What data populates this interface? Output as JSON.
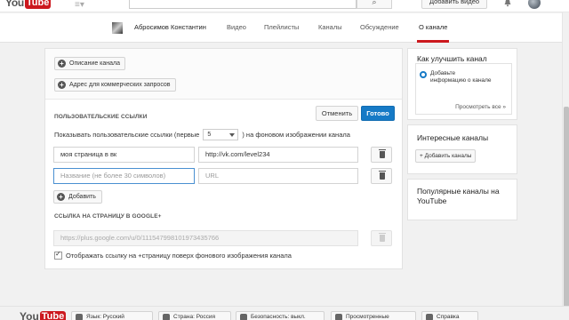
{
  "topbar": {
    "logo_you": "You",
    "logo_tube": "Tube",
    "search_button_icon": "search-icon",
    "upload_label": "Добавить видео",
    "notification_icon": "bell-icon"
  },
  "channel_nav": {
    "channel_name": "Абросимов Константин",
    "tabs": [
      {
        "label": "Видео"
      },
      {
        "label": "Плейлисты"
      },
      {
        "label": "Каналы"
      },
      {
        "label": "Обсуждение"
      },
      {
        "label": "О канале"
      }
    ],
    "active_tab": "О канале",
    "accent_color": "#cc181e"
  },
  "about": {
    "description_button": "Описание канала",
    "business_email_button": "Адрес для коммерческих запросов",
    "links_section_title": "ПОЛЬЗОВАТЕЛЬСКИЕ ССЫЛКИ",
    "cancel_label": "Отменить",
    "done_label": "Готово",
    "show_links_prefix": "Показывать пользовательские ссылки (первые",
    "show_links_count": "5",
    "show_links_suffix": ") на фоновом изображении канала",
    "links": [
      {
        "title": "моя страница в вк",
        "url": "http://vk.com/level234"
      },
      {
        "title_placeholder": "Название (не более 30 символов)",
        "url_placeholder": "URL"
      }
    ],
    "add_label": "Добавить",
    "google_section_title": "ССЫЛКА НА СТРАНИЦУ В GOOGLE+",
    "google_url": "https://plus.google.com/u/0/111547998101973435766",
    "show_google_checkbox": "Отображать ссылку на +страницу поверх фонового изображения канала",
    "show_google_checked": true,
    "primary_color": "#167ac6"
  },
  "sidebar": {
    "improve_title": "Как улучшить канал",
    "improve_tip": "Добавьте информацию о канале",
    "improve_see_all": "Просмотреть все »",
    "featured_title": "Интересные каналы",
    "featured_add": "+ Добавить каналы",
    "popular_title": "Популярные каналы на YouTube"
  },
  "footer": {
    "logo_you": "You",
    "logo_tube": "Tube",
    "buttons": [
      {
        "label": "Язык: Русский",
        "icon": "language-icon"
      },
      {
        "label": "Страна: Россия",
        "icon": "globe-icon"
      },
      {
        "label": "Безопасность: выкл.",
        "icon": "shield-icon"
      },
      {
        "label": "Просмотренные",
        "icon": "history-icon"
      },
      {
        "label": "Справка",
        "icon": "help-icon"
      }
    ]
  }
}
